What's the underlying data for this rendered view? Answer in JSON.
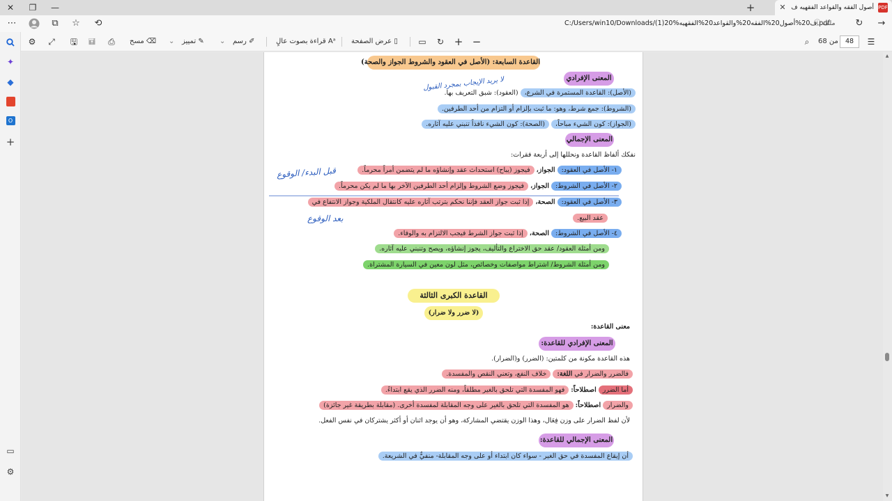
{
  "browser": {
    "tab_title": "أصول الفقه والقواعد الفقهيه ف (1)",
    "tab_close": "✕",
    "new_tab": "+",
    "url": "C:/Users/win10/Downloads/(1)20%ف20%أصول20%الفقه20%والقواعد20%الفقهيه.pdf",
    "file_label": "ملف"
  },
  "pdf_toolbar": {
    "page_current": "48",
    "page_of": "من 68",
    "page_view": "عرض الصفحة",
    "read_aloud": "قراءة بصوت عالٍ",
    "draw": "رسم",
    "highlight": "تمييز",
    "erase": "مسح"
  },
  "doc": {
    "rule7_title": "القاعدة السابعة: (الأصل في العقود والشروط الجواز والصحة)",
    "lit_meaning": "المعنى الإفرادي",
    "l1_a": "(الأصل): القاعدة المستمرة في الشرع،",
    "l1_b": "(العقود): شبق التعريف بها.",
    "l2": "(الشروط): جمع شرط، وهو: ما ثبت بإلزام أو التزام من أحد الطرفين.",
    "l3_a": "(الجواز): كون الشيء مباحاً،",
    "l3_b": "(الصحة): كون الشيء نافذاً تنبني عليه آثاره.",
    "gen_meaning": "المعنى الإجمالي",
    "intro": "نفكك ألفاظ القاعدة ونحللها إلى أربعة فقرات:",
    "p1_a": "١- الأصل في العقود:",
    "p1_b": "الجواز،",
    "p1_c": "فيجوز (يباح) استحداث عقد وإنشاؤه ما لم يتضمن أمراً محرماً.",
    "p2_a": "٢- الأصل في الشروط:",
    "p2_b": "الجواز،",
    "p2_c": "فيجوز وضع الشروط وإلزام أحد الطرفين الآخر بها ما لم يكن محرماً.",
    "p3_a": "٣- الأصل في العقود:",
    "p3_b": "الصحة،",
    "p3_c": "إذا ثبت جواز العقد فإننا نحكم بترتب آثاره عليه كانتقال الملكية وجواز الانتفاع في",
    "p3_d": "عقد البيع.",
    "p4_a": "٤- الأصل في الشروط:",
    "p4_b": "الصحة،",
    "p4_c": "إذا ثبت جواز الشرط فيجب الالتزام به والوفاء.",
    "ex1": "ومن أمثلة العقود/ عقد حق الاختراع والتأليف، يجوز إنشاؤه، ويصح وتنبني عليه آثاره.",
    "ex2": "ومن أمثلة الشروط/ اشتراط مواصفات وخصائص، مثل لون معين في السيارة المشتراة.",
    "rule3_title": "القاعدة الكبرى الثالثة",
    "rule3_sub": "(لا ضرر ولا ضرار)",
    "rule_meaning": "معنى القاعدة:",
    "lit_meaning2": "المعنى الإفرادي للقاعدة:",
    "words": "هذه القاعدة مكونة من كلمتين: (الضرر) و(الضرار).",
    "lang_a": "فالضرر والضرار في",
    "lang_b": "اللغة:",
    "lang_c": "خلاف النفع، وتعني النقص والمفسدة.",
    "term1_a": "أما الضرر",
    "term1_b": "اصطلاحاً:",
    "term1_c": "فهو المفسدة التي تلحق بالغير مطلقاً، ومنه الضرر الذي يقع ابتداءً.",
    "term2_a": "والضرار",
    "term2_b": "اصطلاحاً:",
    "term2_c": "هو المفسدة التي تلحق بالغير على وجه المقابلة لمفسدة أخرى. (مقابلة بطريقة غير جائزة)",
    "because": "لأن لفظ الضرار على وزن فِعَال، وهذا الوزن يقتضي المشاركة، وهو أن يوجد اثنان أو أكثر يشتركان في نفس الفعل.",
    "gen_meaning2": "المعنى الإجمالي للقاعدة:",
    "gen_text": "أن إيقاع المفسدة في حق الغير - سواء كان ابتداء أو على وجه المقابلة- منفيٌّ في الشريعة.",
    "hand1": "لا يريد الإيجاب بمجرد القبول",
    "hand2": "قبل البدء/ الوقوع",
    "hand3": "بعد الوقوع"
  }
}
